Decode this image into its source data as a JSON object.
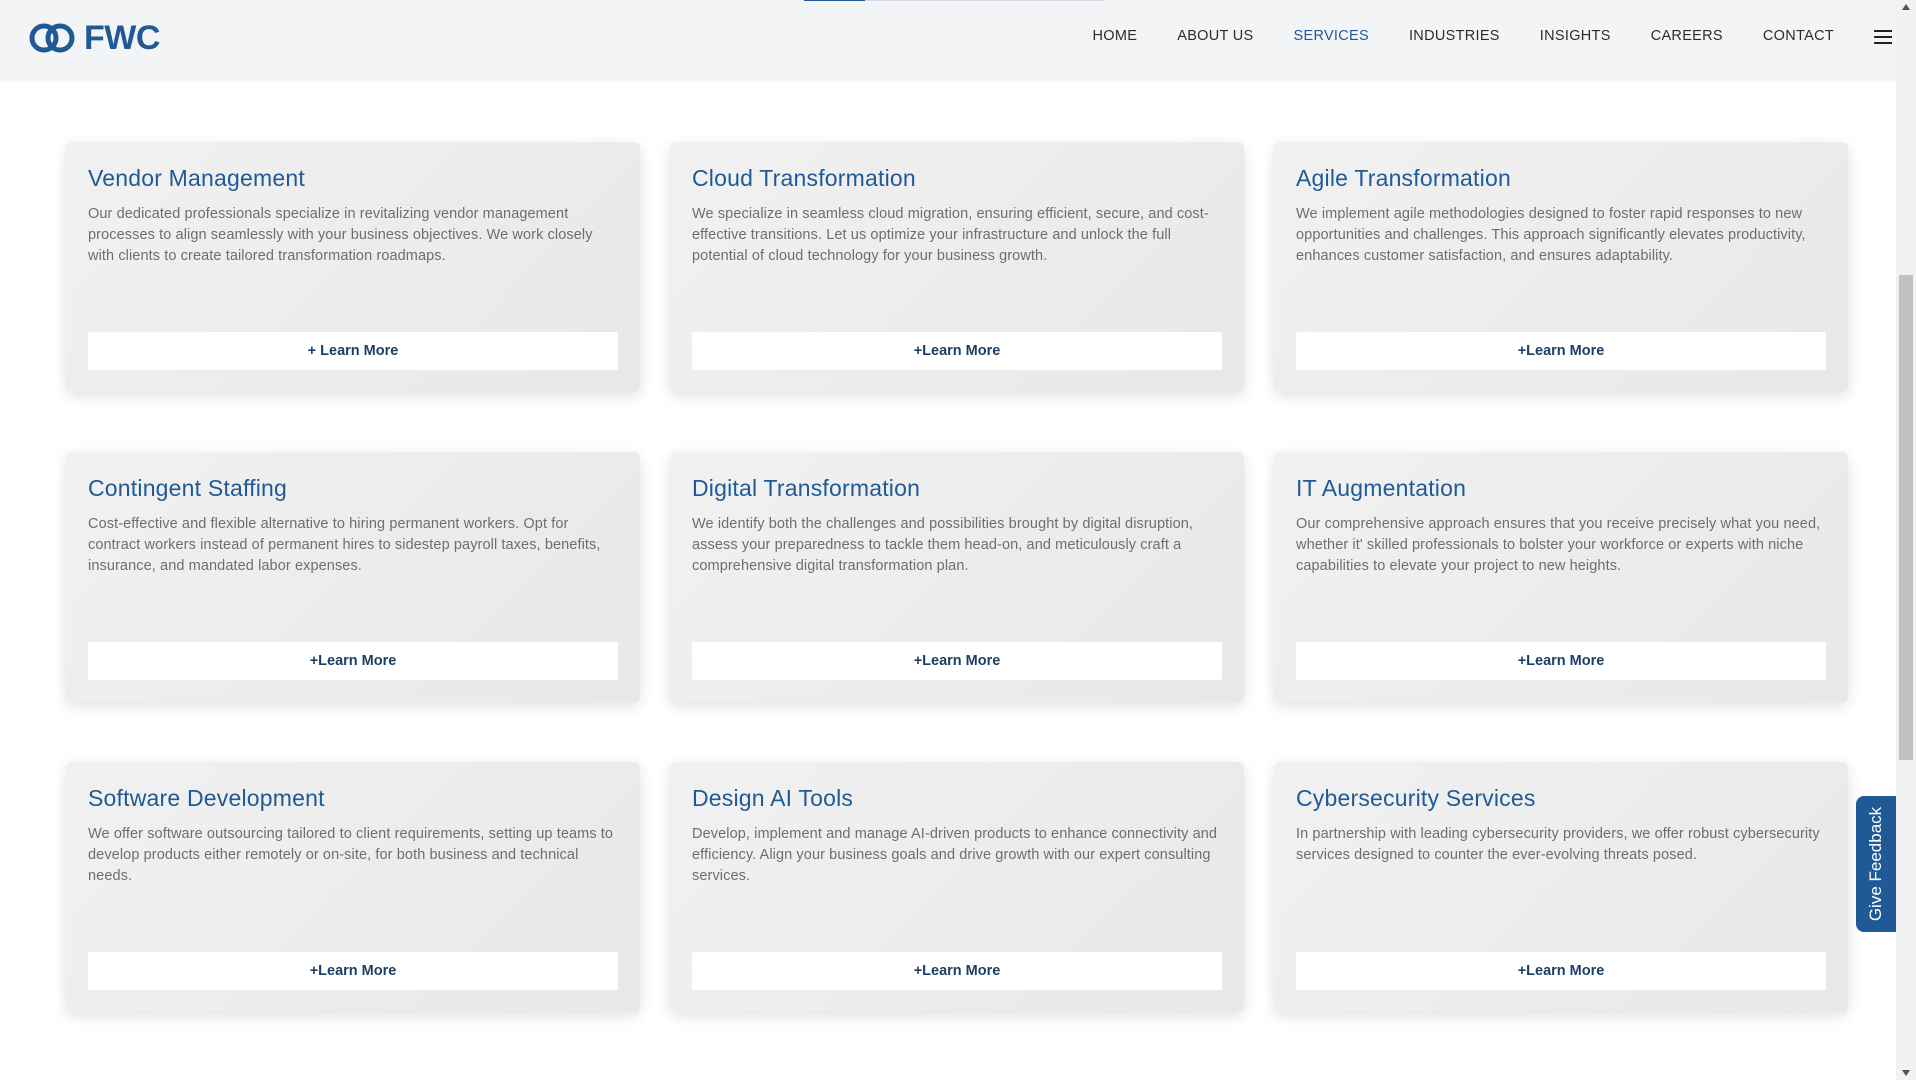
{
  "header": {
    "logo_text": "FWC",
    "nav": [
      {
        "label": "HOME"
      },
      {
        "label": "ABOUT US"
      },
      {
        "label": "SERVICES",
        "active": true
      },
      {
        "label": "INDUSTRIES"
      },
      {
        "label": "INSIGHTS"
      },
      {
        "label": "CAREERS"
      },
      {
        "label": "CONTACT"
      }
    ]
  },
  "services": [
    {
      "title": "Vendor Management",
      "description": "Our dedicated professionals specialize in revitalizing vendor management processes to align seamlessly with your business objectives. We work closely with clients to create tailored transformation roadmaps.",
      "button": "+ Learn More"
    },
    {
      "title": "Cloud Transformation",
      "description": "We specialize in seamless cloud migration, ensuring efficient, secure, and cost-effective transitions. Let us optimize your infrastructure and unlock the full potential of cloud technology for your business growth.",
      "button": "+Learn More"
    },
    {
      "title": "Agile Transformation",
      "description": "We implement agile methodologies designed to foster rapid responses to new opportunities and challenges. This approach significantly elevates productivity, enhances customer satisfaction, and ensures adaptability.",
      "button": "+Learn More"
    },
    {
      "title": "Contingent Staffing",
      "description": "Cost-effective and flexible alternative to hiring permanent workers. Opt for contract workers instead of permanent hires to sidestep payroll taxes, benefits, insurance, and mandated labor expenses.",
      "button": "+Learn More"
    },
    {
      "title": "Digital Transformation",
      "description": "We identify both the challenges and possibilities brought by digital disruption, assess your preparedness to tackle them head-on, and meticulously craft a comprehensive digital transformation plan.",
      "button": "+Learn More"
    },
    {
      "title": "IT Augmentation",
      "description": "Our comprehensive approach ensures that you receive precisely what you need, whether it' skilled professionals to bolster your workforce or experts with niche capabilities to elevate your project to new heights.",
      "button": "+Learn More"
    },
    {
      "title": "Software Development",
      "description": "We offer software outsourcing tailored to client requirements, setting up teams to develop products either remotely or on-site, for both business and technical needs.",
      "button": "+Learn More"
    },
    {
      "title": "Design AI Tools",
      "description": "Develop, implement and manage AI-driven products to enhance connectivity and efficiency. Align your business goals and drive growth with our expert consulting services.",
      "button": "+Learn More"
    },
    {
      "title": "Cybersecurity Services",
      "description": "In partnership with leading cybersecurity providers, we offer robust cybersecurity services designed to counter the ever-evolving threats posed.",
      "button": "+Learn More"
    }
  ],
  "feedback": {
    "label": "Give Feedback"
  },
  "colors": {
    "brand": "#1f5a97",
    "card_bg": "#ececec",
    "text": "#6e6e6e"
  },
  "icons": [
    "logo-mark-icon",
    "hamburger-menu-icon",
    "scroll-up-arrow-icon",
    "scroll-down-arrow-icon"
  ]
}
